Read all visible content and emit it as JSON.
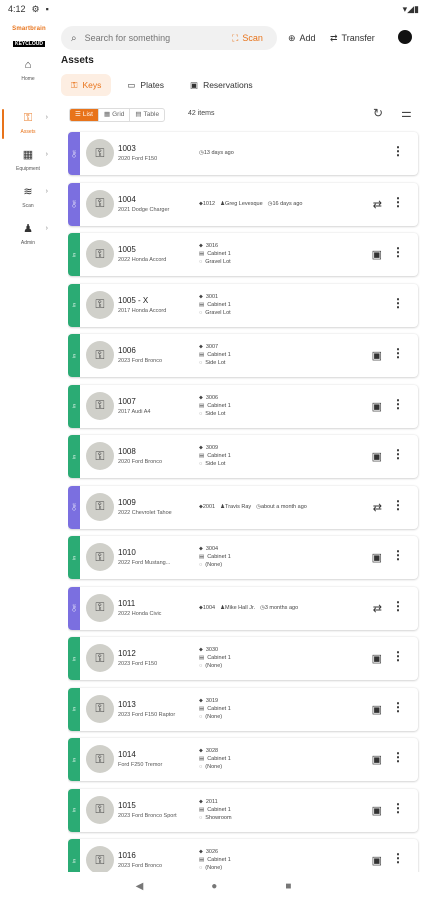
{
  "status": {
    "time": "4:12",
    "right_icons": "▾◢▮"
  },
  "logo": {
    "line1": "Smartbrain",
    "line2": "KEYCLOUD"
  },
  "rail": [
    {
      "label": "Home",
      "icon": "home-icon",
      "glyph": "⌂",
      "active": false
    },
    {
      "label": "Assets",
      "icon": "key-icon",
      "glyph": "⚿",
      "active": true
    },
    {
      "label": "Equipment",
      "icon": "grid-icon",
      "glyph": "▦",
      "active": false
    },
    {
      "label": "Scan",
      "icon": "scan-icon",
      "glyph": "≋",
      "active": false
    },
    {
      "label": "Admin",
      "icon": "admin-icon",
      "glyph": "♟",
      "active": false
    }
  ],
  "search": {
    "placeholder": "Search for something"
  },
  "topbar": {
    "scan": "Scan",
    "add": "Add",
    "transfer": "Transfer"
  },
  "page": {
    "title": "Assets"
  },
  "tabs": [
    {
      "label": "Keys",
      "icon": "key-icon",
      "glyph": "⚿",
      "active": true
    },
    {
      "label": "Plates",
      "icon": "plate-icon",
      "glyph": "▭",
      "active": false
    },
    {
      "label": "Reservations",
      "icon": "calendar-icon",
      "glyph": "▣",
      "active": false
    }
  ],
  "views": [
    {
      "label": "List",
      "glyph": "☰",
      "active": true
    },
    {
      "label": "Grid",
      "glyph": "▦",
      "active": false
    },
    {
      "label": "Table",
      "glyph": "▤",
      "active": false
    }
  ],
  "items_count": "42 items",
  "colors": {
    "in": "#2bab74",
    "out": "#7b6fe0",
    "accent": "#e8731a"
  },
  "assets": [
    {
      "status": "out",
      "strip_label": "Out",
      "name": "1003",
      "vehicle": "2020 Ford F150",
      "type": "time",
      "time": "13 days ago"
    },
    {
      "status": "out",
      "strip_label": "Out",
      "name": "1004",
      "vehicle": "2021 Dodge Charger",
      "type": "holder",
      "slot": "1012",
      "person": "Greg Levesque",
      "time": "16 days ago"
    },
    {
      "status": "in",
      "strip_label": "In",
      "name": "1005",
      "vehicle": "2022 Honda Accord",
      "type": "location",
      "slot": "3016",
      "cabinet": "Cabinet 1",
      "lot": "Gravel Lot"
    },
    {
      "status": "in",
      "strip_label": "In",
      "name": "1005 - X",
      "vehicle": "2017 Honda Accord",
      "type": "location",
      "slot": "3001",
      "cabinet": "Cabinet 1",
      "lot": "Gravel Lot",
      "no_action": true
    },
    {
      "status": "in",
      "strip_label": "In",
      "name": "1006",
      "vehicle": "2023 Ford Bronco",
      "type": "location",
      "slot": "3007",
      "cabinet": "Cabinet 1",
      "lot": "Side Lot"
    },
    {
      "status": "in",
      "strip_label": "In",
      "name": "1007",
      "vehicle": "2017 Audi A4",
      "type": "location",
      "slot": "3006",
      "cabinet": "Cabinet 1",
      "lot": "Side Lot"
    },
    {
      "status": "in",
      "strip_label": "In",
      "name": "1008",
      "vehicle": "2020 Ford Bronco",
      "type": "location",
      "slot": "3009",
      "cabinet": "Cabinet 1",
      "lot": "Side Lot"
    },
    {
      "status": "out",
      "strip_label": "Out",
      "name": "1009",
      "vehicle": "2022 Chevrolet Tahoe",
      "type": "holder",
      "slot": "2001",
      "person": "Travis Ray",
      "time": "about a month ago"
    },
    {
      "status": "in",
      "strip_label": "In",
      "name": "1010",
      "vehicle": "2022 Ford Mustang...",
      "type": "location",
      "slot": "3004",
      "cabinet": "Cabinet 1",
      "lot": "(None)"
    },
    {
      "status": "out",
      "strip_label": "Out",
      "name": "1011",
      "vehicle": "2022 Honda Civic",
      "type": "holder",
      "slot": "1004",
      "person": "Mike Hall Jr.",
      "time": "3 months ago"
    },
    {
      "status": "in",
      "strip_label": "In",
      "name": "1012",
      "vehicle": "2023 Ford F150",
      "type": "location",
      "slot": "3030",
      "cabinet": "Cabinet 1",
      "lot": "(None)"
    },
    {
      "status": "in",
      "strip_label": "In",
      "name": "1013",
      "vehicle": "2023 Ford F150 Raptor",
      "type": "location",
      "slot": "3019",
      "cabinet": "Cabinet 1",
      "lot": "(None)"
    },
    {
      "status": "in",
      "strip_label": "In",
      "name": "1014",
      "vehicle": "Ford F250 Tremor",
      "type": "location",
      "slot": "3028",
      "cabinet": "Cabinet 1",
      "lot": "(None)"
    },
    {
      "status": "in",
      "strip_label": "In",
      "name": "1015",
      "vehicle": "2023 Ford Bronco Sport",
      "type": "location",
      "slot": "2011",
      "cabinet": "Cabinet 1",
      "lot": "Showroom"
    },
    {
      "status": "in",
      "strip_label": "In",
      "name": "1016",
      "vehicle": "2023 Ford Bronco",
      "type": "location",
      "slot": "3026",
      "cabinet": "Cabinet 1",
      "lot": "(None)"
    }
  ],
  "navbar": {
    "back": "◀",
    "home": "●",
    "recents": "■"
  }
}
